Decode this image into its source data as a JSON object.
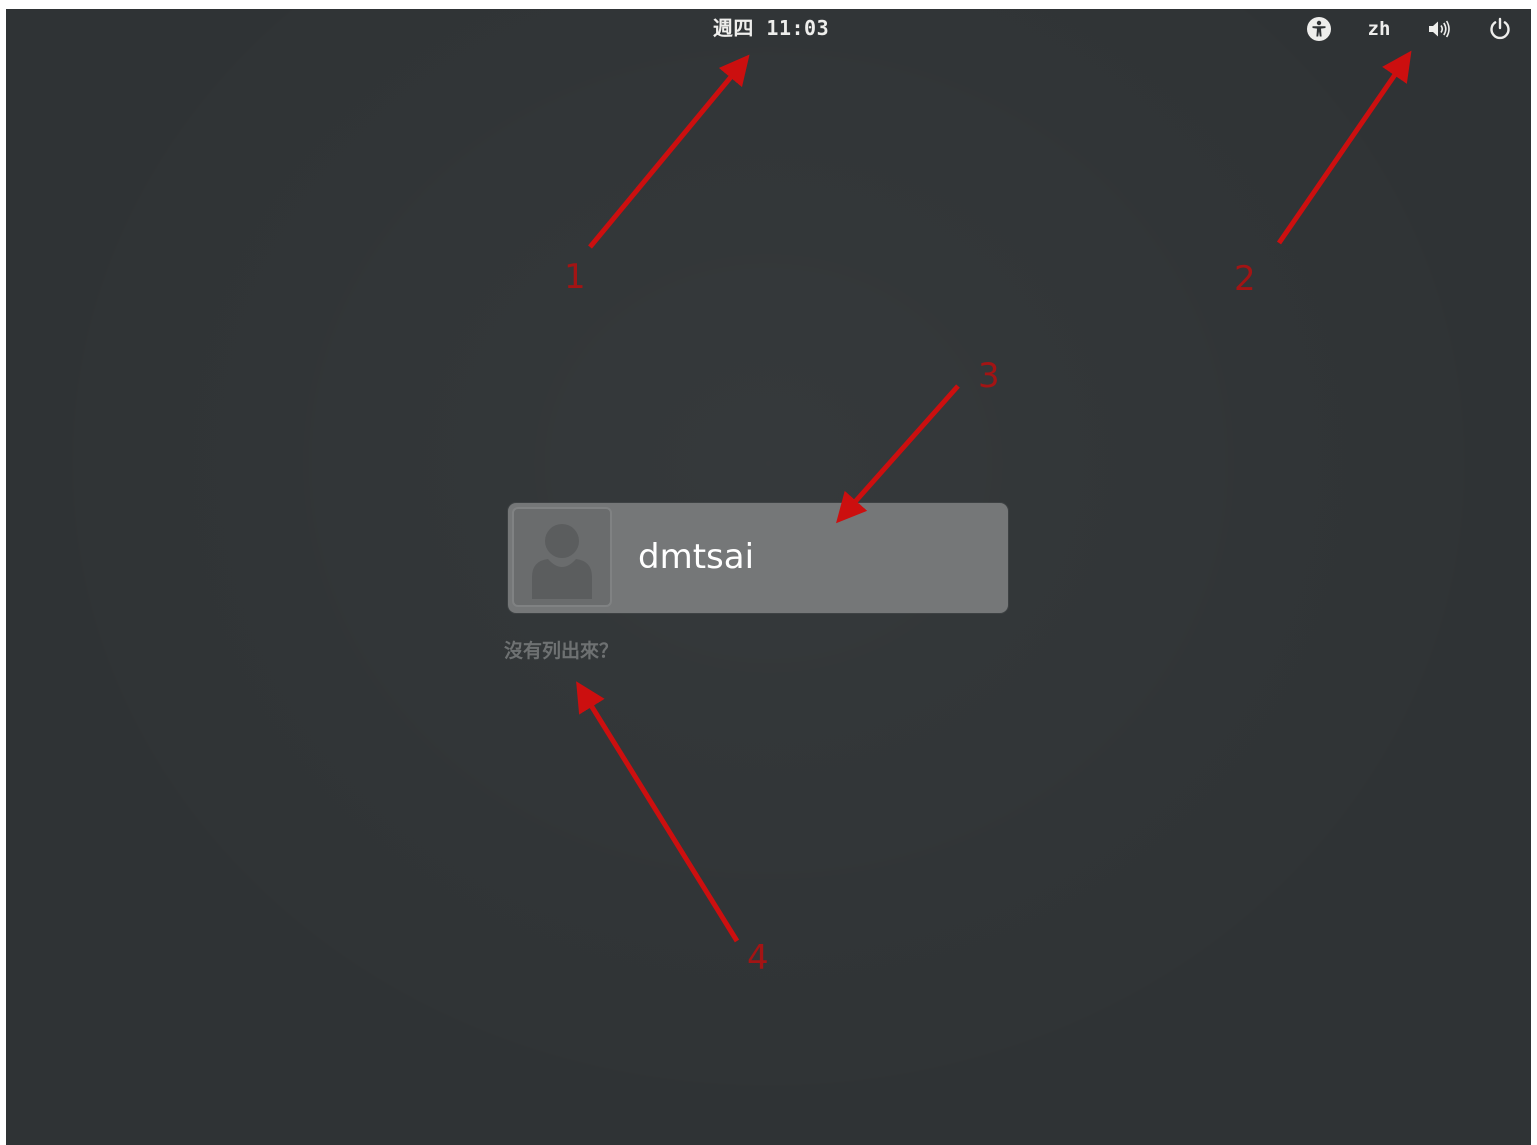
{
  "top_bar": {
    "clock": "週四 11:03",
    "accessibility_icon": "accessibility-icon",
    "language": "zh",
    "volume_icon": "volume-icon",
    "power_icon": "power-icon",
    "text_color": "#eeeeec"
  },
  "user_list": {
    "users": [
      {
        "name": "dmtsai",
        "avatar_icon": "default-user-avatar-icon"
      }
    ],
    "not_listed_label": "沒有列出來？"
  },
  "annotations": {
    "arrow_color": "#cc0f0f",
    "labels": [
      "1",
      "2",
      "3",
      "4"
    ]
  },
  "theme": {
    "background": "#2f3335",
    "card_background": "#757778"
  }
}
